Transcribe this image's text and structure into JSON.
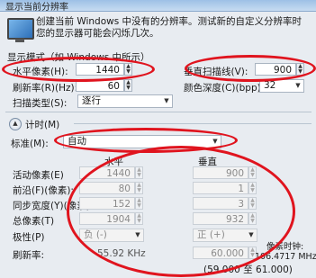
{
  "window": {
    "title": "显示当前分辨率"
  },
  "intro": {
    "text": "创建当前 Windows 中没有的分辨率。测试新的自定义分辨率时您的显示器可能会闪烁几次。"
  },
  "display_mode": {
    "header": "显示模式（如 Windows 中所示）",
    "h_pixels": {
      "label": "水平像素(H):",
      "value": "1440"
    },
    "v_lines": {
      "label": "垂直扫描线(V):",
      "value": "900"
    },
    "refresh": {
      "label": "刷新率(R)(Hz):",
      "value": "60"
    },
    "color_depth": {
      "label": "颜色深度(C)(bpp):",
      "value": "32"
    },
    "scan_type": {
      "label": "扫描类型(S):",
      "value": "逐行"
    }
  },
  "timing": {
    "header": "计时(M)",
    "standard": {
      "label": "标准(M):",
      "value": "自动"
    },
    "col_horizontal": "水平",
    "col_vertical": "垂直",
    "rows": [
      {
        "label": "活动像素(E)",
        "h": "1440",
        "v": "900"
      },
      {
        "label": "前沿(F)(像素):",
        "h": "80",
        "v": "1"
      },
      {
        "label": "同步宽度(Y)(像素):",
        "h": "152",
        "v": "3"
      },
      {
        "label": "总像素(T)",
        "h": "1904",
        "v": "932"
      }
    ],
    "polarity": {
      "label": "极性(P)",
      "h": "负 (-)",
      "v": "正 (+)"
    },
    "refresh_rate": {
      "label": "刷新率:",
      "h": "55.92 KHz",
      "v": "60.000"
    },
    "range": "(59.000 至 61.000)",
    "pixel_clock": {
      "label": "像素时钟:",
      "value": "106.4717 MHz"
    }
  }
}
